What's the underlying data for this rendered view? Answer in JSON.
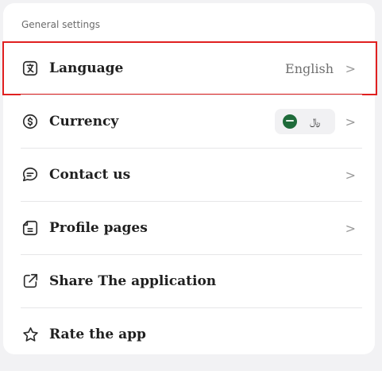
{
  "general_settings": {
    "title": "General settings",
    "items": [
      {
        "label": "Language",
        "value": "English",
        "icon": "language-icon"
      },
      {
        "label": "Currency",
        "value": "",
        "currency_symbol": "﷼",
        "icon": "currency-icon"
      },
      {
        "label": "Contact us",
        "icon": "chat-icon"
      },
      {
        "label": "Profile pages",
        "icon": "profile-pages-icon"
      },
      {
        "label": "Share The application",
        "icon": "share-icon"
      },
      {
        "label": "Rate the app",
        "icon": "star-icon"
      }
    ]
  },
  "colors": {
    "highlight": "#e02020",
    "flag_green": "#1f6b3a"
  }
}
